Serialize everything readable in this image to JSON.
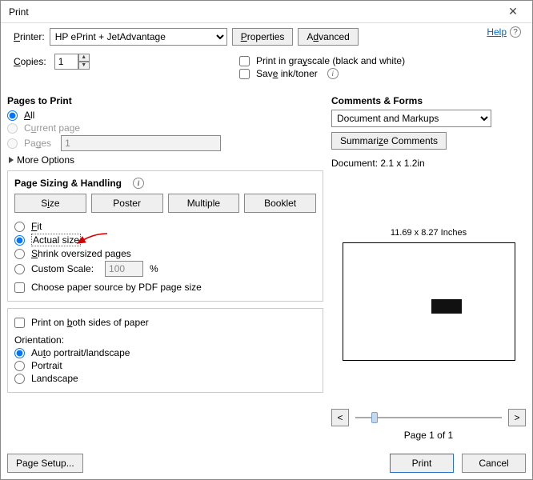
{
  "window": {
    "title": "Print"
  },
  "help": {
    "label": "Help"
  },
  "printer": {
    "label_html": "Printer:",
    "selected": "HP ePrint + JetAdvantage",
    "properties_btn": "Properties",
    "advanced_btn": "Advanced"
  },
  "copies": {
    "label_html": "Copies:",
    "value": "1"
  },
  "options": {
    "grayscale": "Print in grayscale (black and white)",
    "save_ink": "Save ink/toner"
  },
  "pages_to_print": {
    "heading": "Pages to Print",
    "all": "All",
    "current": "Current page",
    "pages": "Pages",
    "pages_value": "1",
    "more": "More Options"
  },
  "sizing": {
    "heading": "Page Sizing & Handling",
    "tabs": {
      "size": "Size",
      "poster": "Poster",
      "multiple": "Multiple",
      "booklet": "Booklet"
    },
    "fit": "Fit",
    "actual": "Actual size",
    "shrink": "Shrink oversized pages",
    "custom": "Custom Scale:",
    "custom_value": "100",
    "custom_pct": "%",
    "choose_source": "Choose paper source by PDF page size"
  },
  "duplex": {
    "label": "Print on both sides of paper"
  },
  "orientation": {
    "heading": "Orientation:",
    "auto": "Auto portrait/landscape",
    "portrait": "Portrait",
    "landscape": "Landscape"
  },
  "comments": {
    "heading": "Comments & Forms",
    "selected": "Document and Markups",
    "summarize": "Summarize Comments"
  },
  "preview": {
    "doc_size": "Document: 2.1 x 1.2in",
    "paper_dim": "11.69 x 8.27 Inches",
    "page_of": "Page 1 of 1"
  },
  "footer": {
    "page_setup": "Page Setup...",
    "print": "Print",
    "cancel": "Cancel"
  }
}
